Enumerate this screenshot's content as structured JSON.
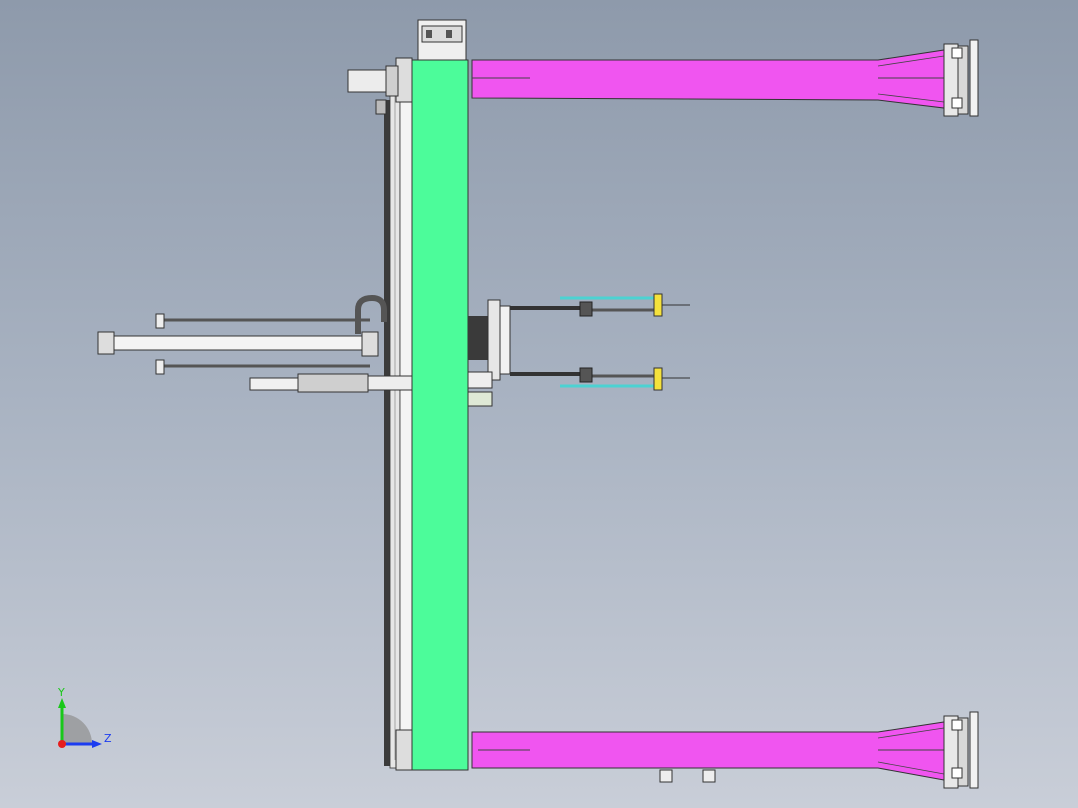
{
  "window": {
    "title": ""
  },
  "view": {
    "background_top": "#8e9aab",
    "background_bottom": "#c9ced8"
  },
  "colors": {
    "column": "#4cfc9a",
    "beam": "#f055f0",
    "cylinder_rod": "#4cd2d2",
    "marker": "#f5e23c"
  },
  "triad": {
    "y_label": "Y",
    "z_label": "Z",
    "y_color": "#19c819",
    "z_color": "#1c3cf0",
    "x_color": "#e61e1e"
  }
}
